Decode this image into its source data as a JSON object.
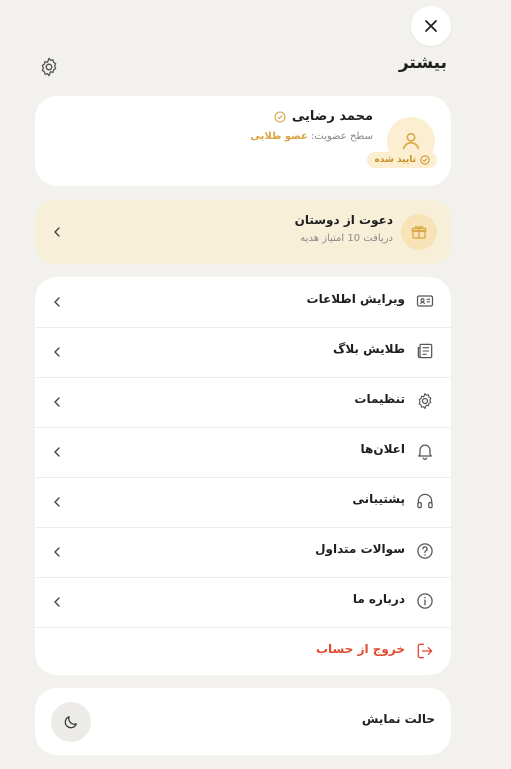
{
  "header": {
    "title": "بیشتر"
  },
  "profile": {
    "name": "محمد رضایی",
    "membership_prefix": "سطح عضویت:",
    "membership_level": "عضو طلایی",
    "verified_label": "تایید شده"
  },
  "invite": {
    "title": "دعوت از دوستان",
    "subtitle": "دریافت 10 امتیاز هدیه"
  },
  "menu": {
    "items": [
      {
        "label": "ویرایش اطلاعات",
        "icon": "id-card-icon"
      },
      {
        "label": "طلایش بلاگ",
        "icon": "newspaper-icon"
      },
      {
        "label": "تنظیمات",
        "icon": "gear-icon"
      },
      {
        "label": "اعلان‌ها",
        "icon": "bell-icon"
      },
      {
        "label": "پشتیبانی",
        "icon": "headphones-icon"
      },
      {
        "label": "سوالات متداول",
        "icon": "question-icon"
      },
      {
        "label": "درباره ما",
        "icon": "info-icon"
      }
    ],
    "logout_label": "خروج از حساب"
  },
  "theme": {
    "label": "حالت نمایش"
  },
  "colors": {
    "accent": "#d9a441",
    "danger": "#e04a2f",
    "background": "#f3f1ed"
  }
}
